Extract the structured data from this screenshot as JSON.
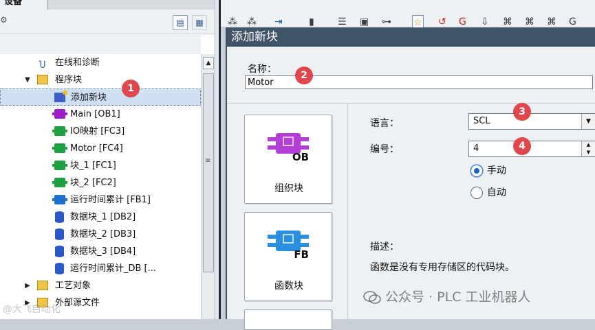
{
  "left_panel": {
    "header_tab": "设备",
    "tree": [
      {
        "label": "在线和诊断",
        "icon": "diagnostics-icon",
        "indent": 1,
        "twisty": ""
      },
      {
        "label": "程序块",
        "icon": "folder-icon",
        "indent": 1,
        "twisty": "▼"
      },
      {
        "label": "添加新块",
        "icon": "add-block-icon",
        "indent": 2,
        "twisty": "",
        "selected": true
      },
      {
        "label": "Main [OB1]",
        "icon": "ob-block-icon",
        "indent": 2,
        "twisty": ""
      },
      {
        "label": "IO映射 [FC3]",
        "icon": "fc-block-icon",
        "indent": 2,
        "twisty": ""
      },
      {
        "label": "Motor [FC4]",
        "icon": "fc-block-icon",
        "indent": 2,
        "twisty": ""
      },
      {
        "label": "块_1 [FC1]",
        "icon": "fc-block-icon",
        "indent": 2,
        "twisty": ""
      },
      {
        "label": "块_2 [FC2]",
        "icon": "fc-block-icon",
        "indent": 2,
        "twisty": ""
      },
      {
        "label": "运行时间累计 [FB1]",
        "icon": "fb-block-icon",
        "indent": 2,
        "twisty": ""
      },
      {
        "label": "数据块_1 [DB2]",
        "icon": "db-block-icon",
        "indent": 2,
        "twisty": ""
      },
      {
        "label": "数据块_2 [DB3]",
        "icon": "db-block-icon",
        "indent": 2,
        "twisty": ""
      },
      {
        "label": "数据块_3 [DB4]",
        "icon": "db-block-icon",
        "indent": 2,
        "twisty": ""
      },
      {
        "label": "运行时间累计_DB [...",
        "icon": "db-block-icon",
        "indent": 2,
        "twisty": ""
      },
      {
        "label": "工艺对象",
        "icon": "folder-icon",
        "indent": 1,
        "twisty": "▶"
      },
      {
        "label": "外部源文件",
        "icon": "folder-icon",
        "indent": 1,
        "twisty": "▶"
      }
    ]
  },
  "dialog": {
    "title": "添加新块",
    "name_label": "名称：",
    "name_value": "Motor",
    "block_types": [
      {
        "caption": "组织块",
        "tag": "OB",
        "color": "#b43fd8"
      },
      {
        "caption": "函数块",
        "tag": "FB",
        "color": "#2a8fe0"
      }
    ],
    "language_label": "语言：",
    "language_value": "SCL",
    "number_label": "编号：",
    "number_value": "4",
    "radio_manual": "手动",
    "radio_auto": "自动",
    "desc_label": "描述：",
    "desc_text": "函数是没有专用存储区的代码块。"
  },
  "markers": [
    "1",
    "2",
    "3",
    "4"
  ],
  "watermark": {
    "right": "公众号 · PLC 工业机器人",
    "left": "@大飞自动化"
  }
}
